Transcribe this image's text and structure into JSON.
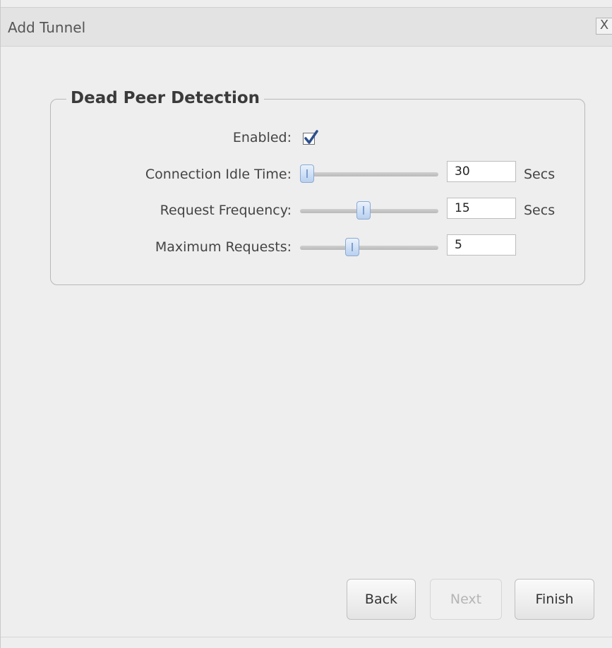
{
  "window": {
    "title": "Add Tunnel",
    "close_label": "X"
  },
  "group": {
    "legend": "Dead Peer Detection",
    "enabled": {
      "label": "Enabled:",
      "checked": true
    },
    "idle_time": {
      "label": "Connection Idle Time:",
      "value": "30",
      "unit": "Secs",
      "slider_fraction": 0.05
    },
    "request_frequency": {
      "label": "Request Frequency:",
      "value": "15",
      "unit": "Secs",
      "slider_fraction": 0.46
    },
    "max_requests": {
      "label": "Maximum Requests:",
      "value": "5",
      "slider_fraction": 0.38
    }
  },
  "buttons": {
    "back": "Back",
    "next": "Next",
    "finish": "Finish"
  },
  "colors": {
    "accent": "#8aaad4",
    "checkbox_check": "#2c4f8c"
  }
}
